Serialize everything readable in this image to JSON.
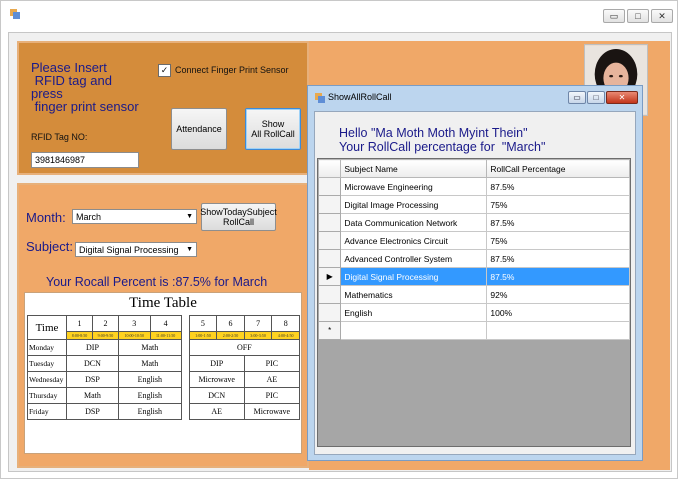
{
  "main": {
    "window_controls": {
      "minimize": "▭",
      "maximize": "□",
      "close": "✕"
    }
  },
  "rfid_panel": {
    "instruction": [
      "Please Insert",
      " RFID tag and",
      "press",
      " finger print sensor"
    ],
    "connect_checkbox_label": "Connect Finger Print Sensor",
    "connect_checked": true,
    "tag_label": "RFID Tag NO:",
    "tag_value": "3981846987",
    "attendance_button": "Attendance",
    "show_all_button": [
      "Show",
      "All RollCall"
    ]
  },
  "rollcall_panel": {
    "month_label": "Month:",
    "month_value": "March",
    "subject_label": "Subject:",
    "subject_value": "Digital Signal Processing",
    "show_today_button": [
      "ShowTodaySubject",
      "RollCall"
    ],
    "result_text": "Your Rocall Percent is :87.5% for March"
  },
  "timetable": {
    "title": "Time Table",
    "time_label": "Time",
    "periods": [
      "1",
      "2",
      "3",
      "4",
      "5",
      "6",
      "7",
      "8"
    ],
    "times": [
      "8:00-8:50",
      "9:00-9:50",
      "10:00-10:50",
      "11:00-11:50",
      "1:00-1:50",
      "2:00-2:50",
      "3:00-3:50",
      "4:00-4:50"
    ],
    "days": [
      {
        "day": "Monday",
        "a": "DIP",
        "b": "Math",
        "c": "OFF",
        "d": ""
      },
      {
        "day": "Tuesday",
        "a": "DCN",
        "b": "Math",
        "c": "DIP",
        "d": "PIC"
      },
      {
        "day": "Wednesday",
        "a": "DSP",
        "b": "English",
        "c": "Microwave",
        "d": "AE"
      },
      {
        "day": "Thursday",
        "a": "Math",
        "b": "English",
        "c": "DCN",
        "d": "PIC"
      },
      {
        "day": "Friday",
        "a": "DSP",
        "b": "English",
        "c": "AE",
        "d": "Microwave"
      }
    ]
  },
  "popup": {
    "title": "ShowAllRollCall",
    "greeting_line1": "Hello \"Ma Moth Moth Myint Thein\"",
    "greeting_line2": "Your RollCall percentage for  \"March\"",
    "columns": [
      "Subject Name",
      "RollCall Percentage"
    ],
    "rows": [
      {
        "subject": "Microwave Engineering",
        "pct": "87.5%"
      },
      {
        "subject": "Digital Image Processing",
        "pct": "75%"
      },
      {
        "subject": "Data Communication Network",
        "pct": "87.5%"
      },
      {
        "subject": "Advance Electronics Circuit",
        "pct": "75%"
      },
      {
        "subject": "Advanced Controller System",
        "pct": "87.5%"
      },
      {
        "subject": "Digital Signal Processing",
        "pct": "87.5%"
      },
      {
        "subject": "Mathematics",
        "pct": "92%"
      },
      {
        "subject": "English",
        "pct": "100%"
      }
    ],
    "selected_row": 5,
    "new_row_marker": "*",
    "current_row_marker": "▶"
  },
  "colors": {
    "panel_dark": "#d48c3b",
    "panel_light": "#f0a868",
    "title_text": "#1a1a8a",
    "selection": "#3399ff",
    "time_cells": "#ffd21f"
  }
}
